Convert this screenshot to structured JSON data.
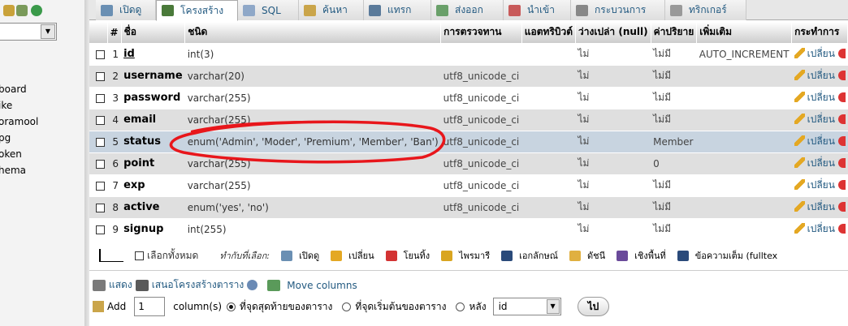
{
  "sidebar": {
    "items": [
      "board",
      "ike",
      "oramool",
      "pg",
      "oken",
      "hema"
    ]
  },
  "tabs": [
    {
      "label": "เปิดดู",
      "icon": "browse-icon",
      "color": "#6a8fb3"
    },
    {
      "label": "โครงสร้าง",
      "icon": "structure-icon",
      "color": "#4a7a3a"
    },
    {
      "label": "SQL",
      "icon": "sql-icon",
      "color": "#8fa8c8"
    },
    {
      "label": "ค้นหา",
      "icon": "search-icon",
      "color": "#caa54a"
    },
    {
      "label": "แทรก",
      "icon": "insert-icon",
      "color": "#5a7a9a"
    },
    {
      "label": "ส่งออก",
      "icon": "export-icon",
      "color": "#6aa06a"
    },
    {
      "label": "นำเข้า",
      "icon": "import-icon",
      "color": "#c85a5a"
    },
    {
      "label": "กระบวนการ",
      "icon": "wrench-icon",
      "color": "#888888"
    },
    {
      "label": "ทริกเกอร์",
      "icon": "triggers-icon",
      "color": "#999999"
    }
  ],
  "table": {
    "headers": [
      "#",
      "ชื่อ",
      "ชนิด",
      "การตรวจทาน",
      "แอตทริบิวต์",
      "ว่างเปล่า (null)",
      "ค่าปริยาย",
      "เพิ่มเติม",
      "กระทำการ"
    ],
    "rows": [
      {
        "num": "1",
        "name": "id",
        "type": "int(3)",
        "collation": "",
        "attributes": "",
        "null": "ไม่",
        "default": "ไม่มี",
        "extra": "AUTO_INCREMENT",
        "action": "เปลี่ยน"
      },
      {
        "num": "2",
        "name": "username",
        "type": "varchar(20)",
        "collation": "utf8_unicode_ci",
        "attributes": "",
        "null": "ไม่",
        "default": "ไม่มี",
        "extra": "",
        "action": "เปลี่ยน"
      },
      {
        "num": "3",
        "name": "password",
        "type": "varchar(255)",
        "collation": "utf8_unicode_ci",
        "attributes": "",
        "null": "ไม่",
        "default": "ไม่มี",
        "extra": "",
        "action": "เปลี่ยน"
      },
      {
        "num": "4",
        "name": "email",
        "type": "varchar(255)",
        "collation": "utf8_unicode_ci",
        "attributes": "",
        "null": "ไม่",
        "default": "ไม่มี",
        "extra": "",
        "action": "เปลี่ยน"
      },
      {
        "num": "5",
        "name": "status",
        "type": "enum('Admin', 'Moder', 'Premium', 'Member', 'Ban')",
        "collation": "utf8_unicode_ci",
        "attributes": "",
        "null": "ไม่",
        "default": "Member",
        "extra": "",
        "action": "เปลี่ยน"
      },
      {
        "num": "6",
        "name": "point",
        "type": "varchar(255)",
        "collation": "utf8_unicode_ci",
        "attributes": "",
        "null": "ไม่",
        "default": "0",
        "extra": "",
        "action": "เปลี่ยน"
      },
      {
        "num": "7",
        "name": "exp",
        "type": "varchar(255)",
        "collation": "utf8_unicode_ci",
        "attributes": "",
        "null": "ไม่",
        "default": "ไม่มี",
        "extra": "",
        "action": "เปลี่ยน"
      },
      {
        "num": "8",
        "name": "active",
        "type": "enum('yes', 'no')",
        "collation": "utf8_unicode_ci",
        "attributes": "",
        "null": "ไม่",
        "default": "ไม่มี",
        "extra": "",
        "action": "เปลี่ยน"
      },
      {
        "num": "9",
        "name": "signup",
        "type": "int(255)",
        "collation": "",
        "attributes": "",
        "null": "ไม่",
        "default": "ไม่มี",
        "extra": "",
        "action": "เปลี่ยน"
      }
    ]
  },
  "with_selected": {
    "check_all": "เลือกทั้งหมด",
    "label": "ทำกับที่เลือก:",
    "actions": [
      {
        "label": "เปิดดู",
        "icon": "browse-icon",
        "color": "#6a8fb3"
      },
      {
        "label": "เปลี่ยน",
        "icon": "pencil-icon",
        "color": "#e4a823"
      },
      {
        "label": "โยนทิ้ง",
        "icon": "drop-icon",
        "color": "#d33333"
      },
      {
        "label": "ไพรมารี",
        "icon": "key-icon",
        "color": "#d9a520"
      },
      {
        "label": "เอกลักษณ์",
        "icon": "unique-icon",
        "color": "#2a4a7a"
      },
      {
        "label": "ดัชนี",
        "icon": "index-icon",
        "color": "#e0b040"
      },
      {
        "label": "เชิงพื้นที่",
        "icon": "spatial-icon",
        "color": "#6a4a9a"
      },
      {
        "label": "ข้อความเต็ม (fulltex",
        "icon": "fulltext-icon",
        "color": "#2a4a7a"
      }
    ]
  },
  "footer_links": {
    "print": "แสดง",
    "propose": "เสนอโครงสร้างตาราง",
    "move": "Move columns"
  },
  "add_columns": {
    "label": "Add",
    "count": "1",
    "unit": "column(s)",
    "opt_end": "ที่จุดสุดท้ายของตาราง",
    "opt_begin": "ที่จุดเริ่มต้นของตาราง",
    "opt_after": "หลัง",
    "after_field": "id",
    "go": "ไป"
  }
}
